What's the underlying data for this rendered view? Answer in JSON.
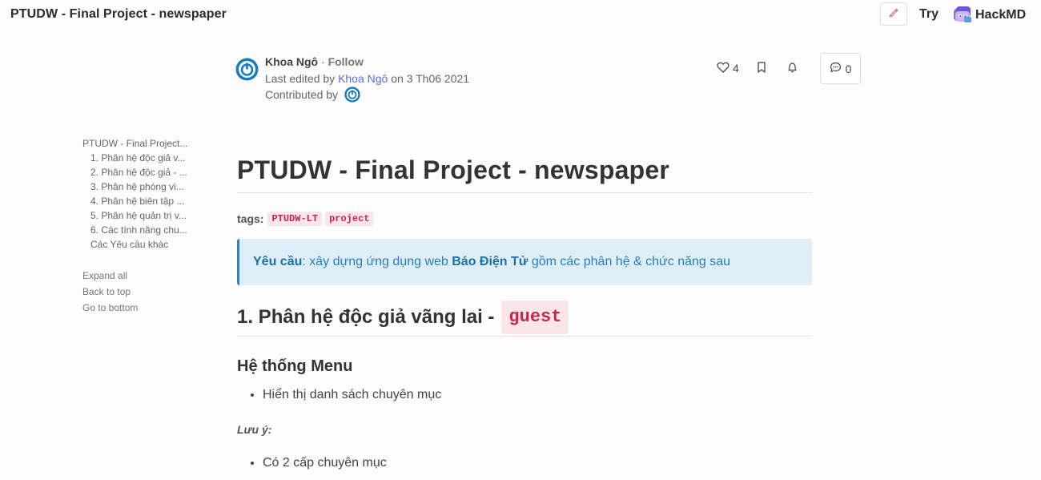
{
  "header": {
    "title": "PTUDW - Final Project - newspaper",
    "try_label": "Try",
    "brand": "HackMD"
  },
  "author": {
    "name": "Khoa Ngô",
    "separator": "·",
    "follow": "Follow",
    "edited_prefix": "Last edited by",
    "edited_by": "Khoa Ngô",
    "edited_suffix": "on 3 Th06 2021",
    "contributed_label": "Contributed by"
  },
  "actions": {
    "likes": "4",
    "comments": "0"
  },
  "toc": {
    "top": "PTUDW - Final Project...",
    "items": [
      "1. Phân hệ độc giả v...",
      "2. Phân hệ độc giả - ...",
      "3. Phân hệ phóng vi...",
      "4. Phân hệ biên tập ...",
      "5. Phân hệ quản trị v...",
      "6. Các tính năng chu...",
      "Các Yêu cầu khác"
    ],
    "expand_all": "Expand all",
    "back_to_top": "Back to top",
    "go_to_bottom": "Go to bottom"
  },
  "doc": {
    "title": "PTUDW - Final Project - newspaper",
    "tags_label": "tags:",
    "tags": [
      "PTUDW-LT",
      "project"
    ],
    "alert": {
      "bold_label": "Yêu cầu",
      "text_a": ": xây dựng ứng dụng web ",
      "bold_name": "Báo Điện Tử",
      "text_b": " gồm các phân hệ & chức năng sau"
    },
    "section1": {
      "heading": "1. Phân hệ độc giả vãng lai -",
      "code": "guest"
    },
    "subheading": "Hệ thống Menu",
    "list1": [
      "Hiển thị danh sách chuyên mục"
    ],
    "note": "Lưu ý:",
    "list2": [
      "Có 2 cấp chuyên mục"
    ]
  },
  "colors": {
    "link": "#5b6fd8",
    "tag_text": "#c7254e",
    "tag_bg": "#f9e6e6",
    "alert_bg": "#ddeef9",
    "alert_border": "#2b82c4",
    "avatar_blue": "#1a7bc1"
  },
  "icons": {
    "edit": "pen-icon",
    "like": "heart-icon",
    "bookmark": "bookmark-icon",
    "notify": "bell-icon",
    "comment": "comment-bubble-icon"
  }
}
